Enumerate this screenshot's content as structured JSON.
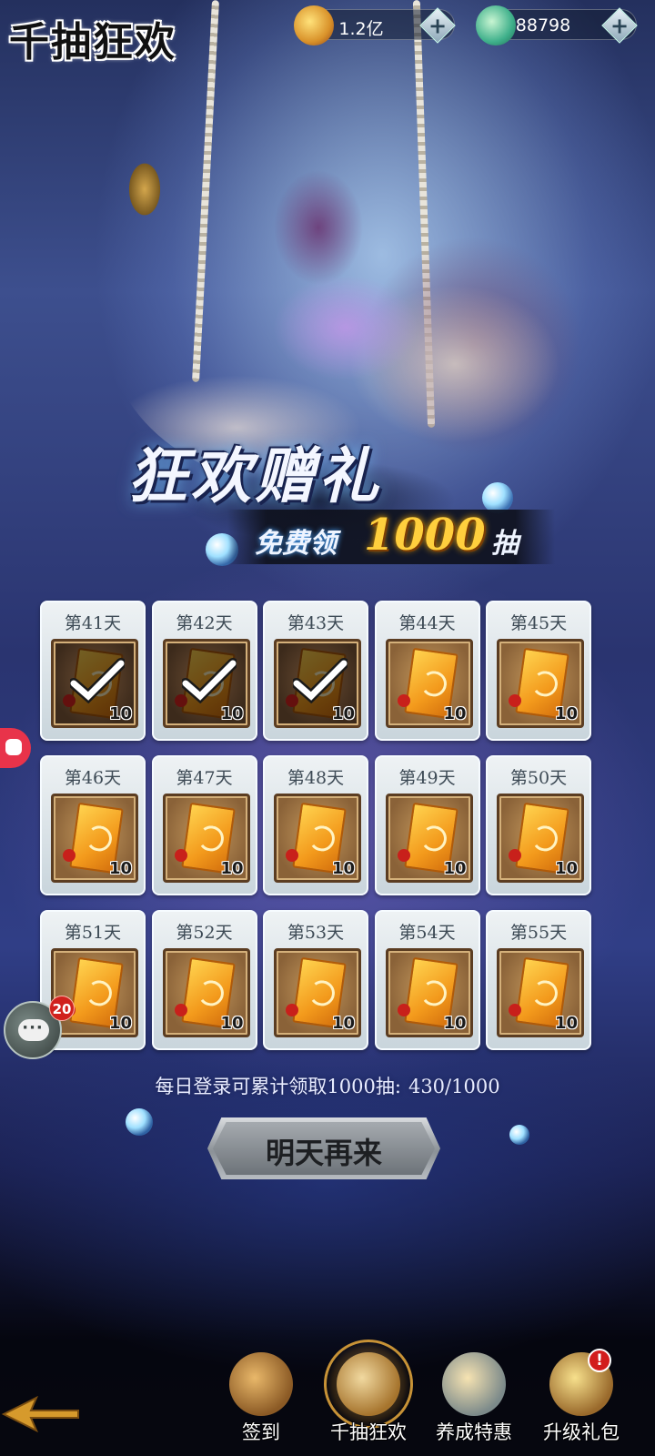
{
  "header": {
    "title": "千抽狂欢",
    "currencies": [
      {
        "icon": "gold-coin-icon",
        "value": "1.2亿"
      },
      {
        "icon": "jade-icon",
        "value": "88798"
      }
    ],
    "plus_label": "+"
  },
  "banner": {
    "main": "狂欢赠礼",
    "free_label": "免费领",
    "amount": "1000",
    "unit": "抽"
  },
  "rewards": {
    "quantity": "10",
    "days": [
      {
        "label": "第41天",
        "claimed": true
      },
      {
        "label": "第42天",
        "claimed": true
      },
      {
        "label": "第43天",
        "claimed": true
      },
      {
        "label": "第44天",
        "claimed": false
      },
      {
        "label": "第45天",
        "claimed": false
      },
      {
        "label": "第46天",
        "claimed": false
      },
      {
        "label": "第47天",
        "claimed": false
      },
      {
        "label": "第48天",
        "claimed": false
      },
      {
        "label": "第49天",
        "claimed": false
      },
      {
        "label": "第50天",
        "claimed": false
      },
      {
        "label": "第51天",
        "claimed": false
      },
      {
        "label": "第52天",
        "claimed": false
      },
      {
        "label": "第53天",
        "claimed": false
      },
      {
        "label": "第54天",
        "claimed": false
      },
      {
        "label": "第55天",
        "claimed": false
      }
    ]
  },
  "progress": {
    "text": "每日登录可累计领取1000抽:",
    "count": "430/1000"
  },
  "action_button": "明天再来",
  "chat": {
    "badge": "20",
    "icon": "chat-icon"
  },
  "bottom_nav": [
    {
      "label": "签到",
      "icon": "scroll-icon",
      "active": false,
      "alert": false
    },
    {
      "label": "千抽狂欢",
      "icon": "chest-icon",
      "active": true,
      "alert": false
    },
    {
      "label": "养成特惠",
      "icon": "coin-chest-icon",
      "active": false,
      "alert": false
    },
    {
      "label": "升级礼包",
      "icon": "cauldron-icon",
      "active": false,
      "alert": true
    }
  ],
  "alert_mark": "!",
  "colors": {
    "accent_gold": "#ffcf3d",
    "claimed_frame": "#3c2a1b",
    "alert_red": "#d21c1c"
  }
}
